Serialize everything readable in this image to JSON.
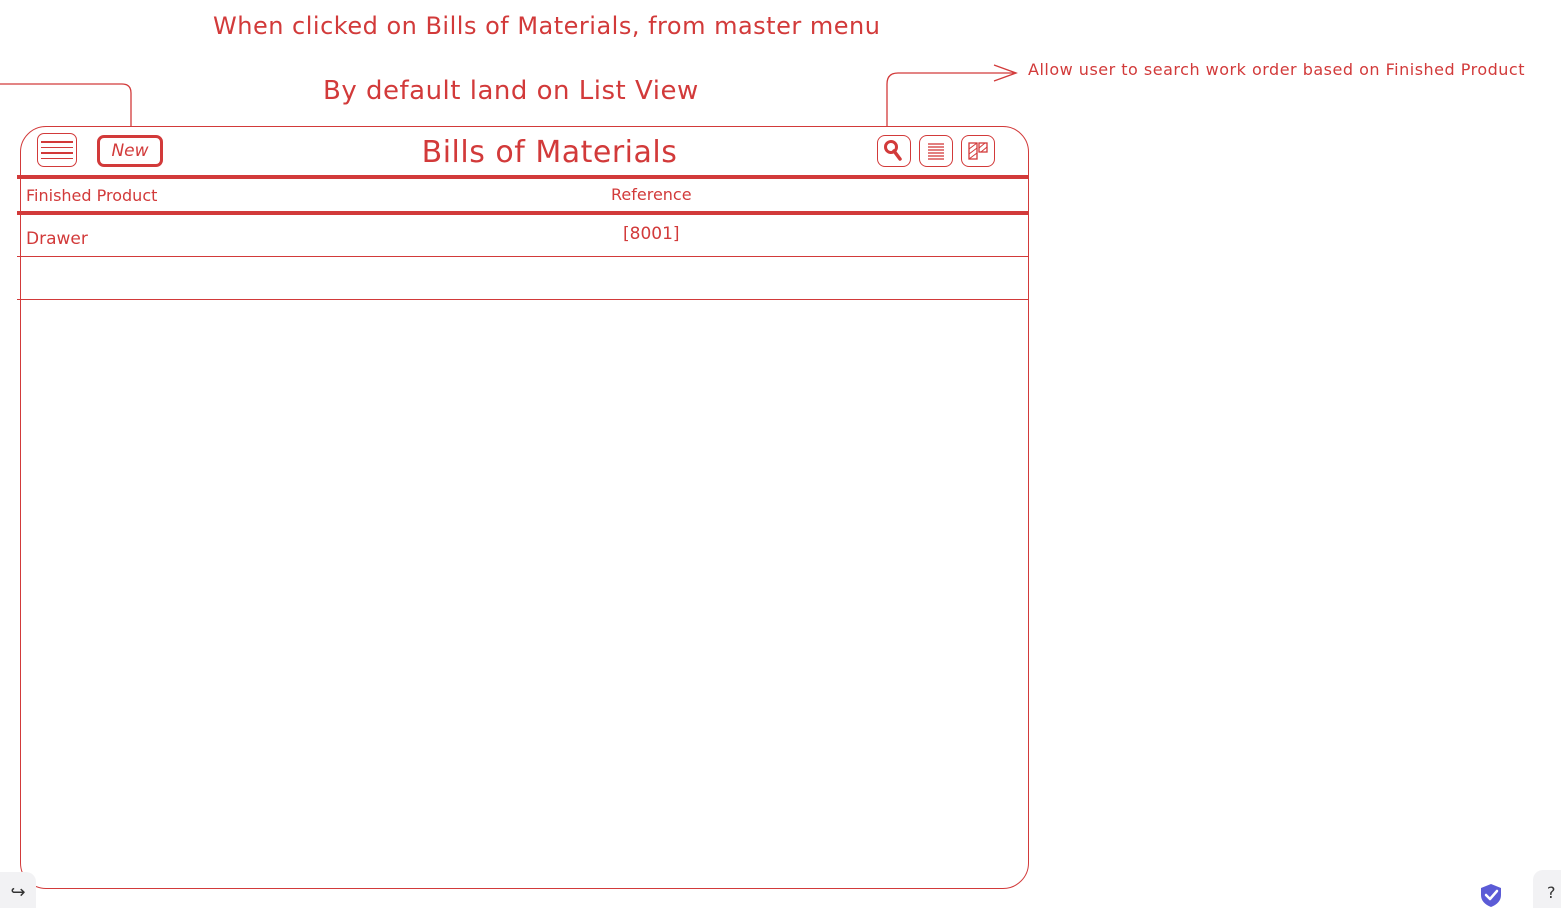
{
  "annotations": {
    "menu_note": "When clicked on Bills of Materials, from master menu",
    "default_view_note": "By default land on List View",
    "search_note": "Allow user to search work order based on Finished Product"
  },
  "window": {
    "title": "Bills of Materials",
    "new_label": "New",
    "icons": [
      "menu-icon",
      "search-icon",
      "list-view-icon",
      "kanban-view-icon"
    ]
  },
  "table": {
    "columns": [
      "Finished Product",
      "Reference"
    ],
    "rows": [
      {
        "finished_product": "Drawer",
        "reference": "[8001]"
      }
    ]
  },
  "footer": {
    "undo_icon": "undo-arrow-icon",
    "shield_icon": "shield-check-icon",
    "help_icon": "help-icon"
  },
  "colors": {
    "accent": "#d23a3a",
    "shield": "#5b5bd6"
  }
}
